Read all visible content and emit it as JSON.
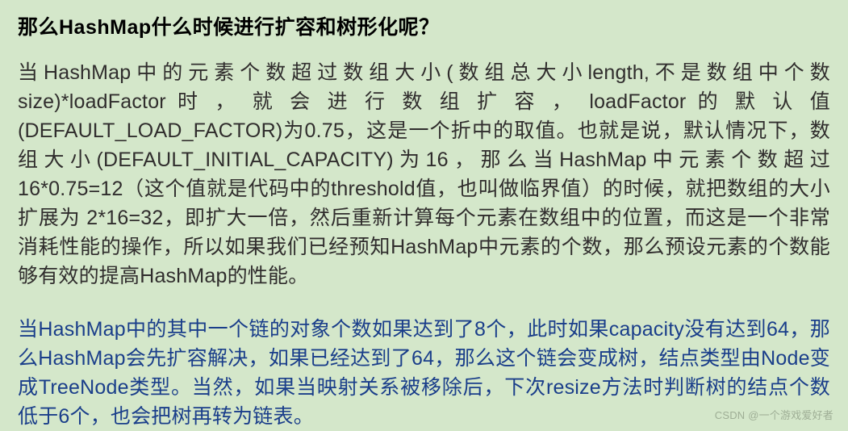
{
  "heading": "那么HashMap什么时候进行扩容和树形化呢？",
  "paragraph1": "当HashMap中的元素个数超过数组大小(数组总大小length,不是数组中个数size)*loadFactor 时 ， 就 会 进 行 数 组 扩 容 ， loadFactor 的 默 认 值(DEFAULT_LOAD_FACTOR)为0.75，这是一个折中的取值。也就是说，默认情况下，数组大小(DEFAULT_INITIAL_CAPACITY)为16，那么当HashMap中元素个数超过16*0.75=12（这个值就是代码中的threshold值，也叫做临界值）的时候，就把数组的大小扩展为 2*16=32，即扩大一倍，然后重新计算每个元素在数组中的位置，而这是一个非常消耗性能的操作，所以如果我们已经预知HashMap中元素的个数，那么预设元素的个数能够有效的提高HashMap的性能。",
  "paragraph2": "当HashMap中的其中一个链的对象个数如果达到了8个，此时如果capacity没有达到64，那么HashMap会先扩容解决，如果已经达到了64，那么这个链会变成树，结点类型由Node变成TreeNode类型。当然，如果当映射关系被移除后，下次resize方法时判断树的结点个数低于6个，也会把树再转为链表。",
  "watermark": "CSDN @一个游戏爱好者"
}
